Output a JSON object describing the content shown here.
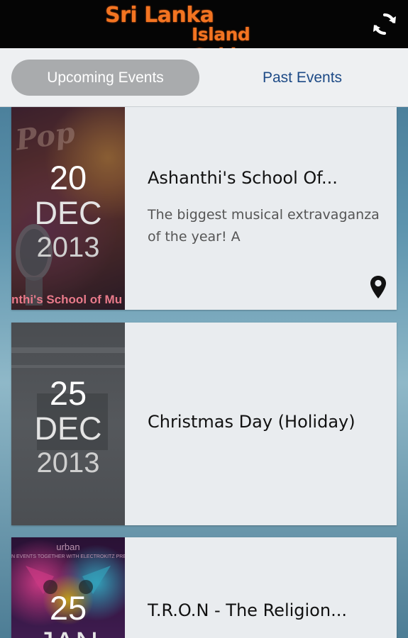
{
  "header": {
    "logo_line1": "Sri Lanka",
    "logo_line2": "Island Guide",
    "refresh_icon": "refresh-icon"
  },
  "tabs": [
    {
      "label": "Upcoming Events",
      "selected": true
    },
    {
      "label": "Past Events",
      "selected": false
    }
  ],
  "events": [
    {
      "day": "20",
      "month": "DEC",
      "year": "2013",
      "title": "Ashanthi's School Of...",
      "description": "The biggest musical extravaganza of the year! A",
      "thumb_text_top": "Pop",
      "thumb_text_bottom": "nthi's School of Mu",
      "has_location": true
    },
    {
      "day": "25",
      "month": "DEC",
      "year": "2013",
      "title": "Christmas Day (Holiday)",
      "description": "",
      "has_location": false
    },
    {
      "day": "25",
      "month": "JAN",
      "year": "",
      "title": "T.R.O.N - The Religion...",
      "description": "",
      "thumb_text_top": "urban",
      "thumb_text_small": "N EVENTS TOGETHER WITH ELECTROKITZ PRES",
      "has_location": false
    }
  ],
  "colors": {
    "header_bg": "#050505",
    "logo": "#f37421",
    "tab_selected_bg": "#a9abad",
    "tab_link": "#1d4a86",
    "card_bg": "#e9ecef"
  }
}
